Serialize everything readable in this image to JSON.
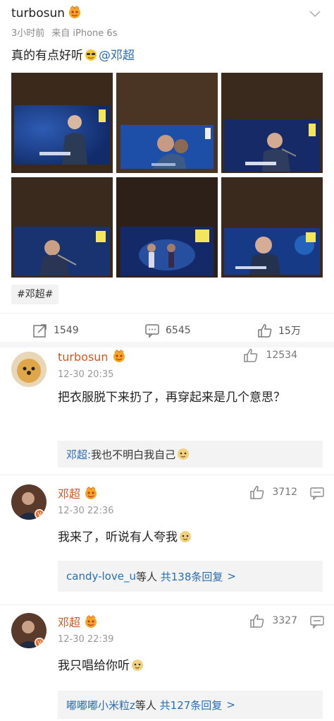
{
  "post": {
    "author": "turbosun",
    "time": "3小时前",
    "source": "来自 iPhone 6s",
    "text_main": "真的有点好听",
    "mention": "@邓超",
    "hashtag": "#邓超#",
    "photos": [
      "photo-1",
      "photo-2",
      "photo-3",
      "photo-4",
      "photo-5",
      "photo-6"
    ]
  },
  "actions": {
    "repost_count": "1549",
    "comment_count": "6545",
    "like_count": "15万"
  },
  "comments": [
    {
      "name": "turbosun",
      "time": "12-30 20:35",
      "likes": "12534",
      "text": "把衣服脱下来扔了，再穿起来是几个意思？",
      "reply_author": "邓超:",
      "reply_text": " 我也不明白我自己"
    },
    {
      "name": "邓超",
      "time": "12-30 22:36",
      "likes": "3712",
      "text": "我来了，听说有人夸我",
      "reply_link": "candy-love_u",
      "reply_suffix": "等人",
      "reply_count": "共138条回复",
      "arrow": ">"
    },
    {
      "name": "邓超",
      "time": "12-30 22:39",
      "likes": "3327",
      "text": "我只唱给你听",
      "reply_link": "嘟嘟嘟小米粒z",
      "reply_suffix": "等人",
      "reply_count": "共127条回复",
      "arrow": ">"
    }
  ],
  "colors": {
    "name_orange": "#d4561f",
    "link_blue": "#2a6db0"
  }
}
